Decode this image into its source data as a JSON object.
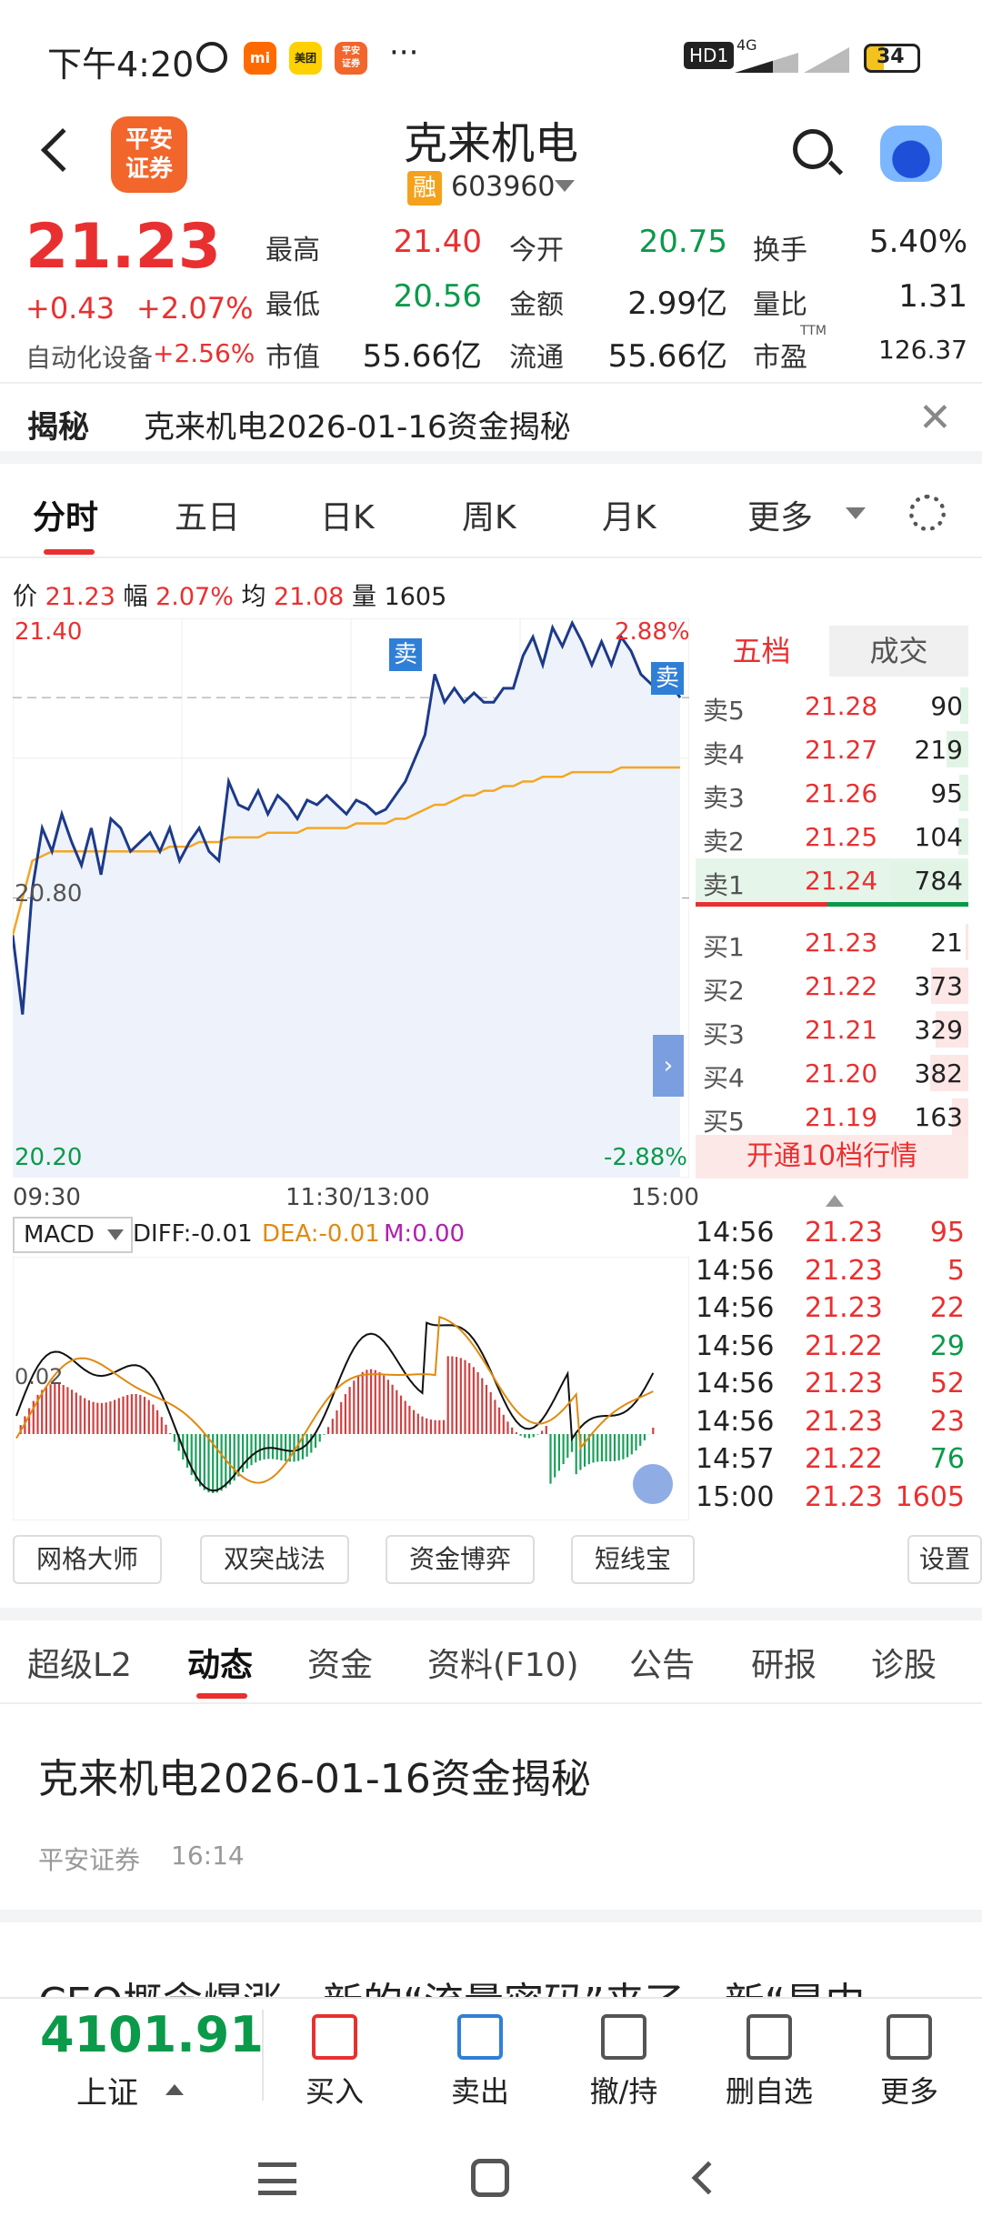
{
  "status_bar": {
    "time": "下午4:20",
    "network": "HD1",
    "signal": "4G",
    "battery": "34"
  },
  "header": {
    "title": "克来机电",
    "badge": "融",
    "code": "603960",
    "logo_text": "平安证券"
  },
  "quote": {
    "price": "21.23",
    "change": "+0.43",
    "change_pct": "+2.07%",
    "sector": "自动化设备",
    "sector_pct": "+2.56%",
    "fields": [
      {
        "label": "最高",
        "value": "21.40",
        "color": "red"
      },
      {
        "label": "今开",
        "value": "20.75",
        "color": "green"
      },
      {
        "label": "换手",
        "value": "5.40%",
        "color": "dark"
      },
      {
        "label": "最低",
        "value": "20.56",
        "color": "green"
      },
      {
        "label": "金额",
        "value": "2.99亿",
        "color": "dark"
      },
      {
        "label": "量比",
        "value": "1.31",
        "color": "dark"
      },
      {
        "label": "市值",
        "value": "55.66亿",
        "color": "dark"
      },
      {
        "label": "流通",
        "value": "55.66亿",
        "color": "dark"
      },
      {
        "label": "市盈",
        "value": "126.37",
        "color": "dark",
        "sup": "TTM"
      }
    ]
  },
  "banner": {
    "tag": "揭秘",
    "text": "克来机电2026-01-16资金揭秘"
  },
  "chart_tabs": [
    "分时",
    "五日",
    "日K",
    "周K",
    "月K",
    "更多"
  ],
  "info_line": {
    "price_lbl": "价",
    "price": "21.23",
    "amp_lbl": "幅",
    "amp": "2.07%",
    "avg_lbl": "均",
    "avg": "21.08",
    "vol_lbl": "量",
    "vol": "1605"
  },
  "chart_data": {
    "type": "line",
    "y_high": "21.40",
    "y_mid": "20.80",
    "y_low": "20.20",
    "pct_high": "2.88%",
    "pct_low": "-2.88%",
    "x_ticks": [
      "09:30",
      "11:30/13:00",
      "15:00"
    ],
    "sell_marker": "卖",
    "series": [
      {
        "name": "价",
        "values": [
          20.72,
          20.55,
          20.82,
          20.95,
          20.9,
          20.98,
          20.92,
          20.87,
          20.95,
          20.85,
          20.97,
          20.95,
          20.9,
          20.92,
          20.94,
          20.9,
          20.95,
          20.88,
          20.92,
          20.95,
          20.9,
          20.88,
          21.05,
          21.0,
          20.99,
          21.03,
          20.98,
          21.02,
          21.0,
          20.97,
          21.01,
          21.0,
          21.02,
          21.0,
          20.98,
          21.01,
          21.0,
          20.98,
          20.99,
          21.02,
          21.05,
          21.1,
          21.15,
          21.28,
          21.22,
          21.25,
          21.22,
          21.24,
          21.22,
          21.22,
          21.25,
          21.25,
          21.32,
          21.36,
          21.3,
          21.38,
          21.34,
          21.39,
          21.35,
          21.3,
          21.35,
          21.3,
          21.36,
          21.33,
          21.28,
          21.26,
          21.24,
          21.26,
          21.23
        ]
      },
      {
        "name": "均",
        "values": [
          20.72,
          20.8,
          20.88,
          20.89,
          20.9,
          20.9,
          20.9,
          20.9,
          20.9,
          20.9,
          20.9,
          20.9,
          20.9,
          20.9,
          20.9,
          20.9,
          20.91,
          20.91,
          20.91,
          20.92,
          20.92,
          20.92,
          20.93,
          20.93,
          20.93,
          20.93,
          20.94,
          20.94,
          20.94,
          20.94,
          20.95,
          20.95,
          20.95,
          20.95,
          20.95,
          20.96,
          20.96,
          20.96,
          20.96,
          20.97,
          20.97,
          20.98,
          20.99,
          21.0,
          21.0,
          21.01,
          21.02,
          21.02,
          21.03,
          21.03,
          21.04,
          21.04,
          21.05,
          21.05,
          21.06,
          21.06,
          21.06,
          21.07,
          21.07,
          21.07,
          21.07,
          21.07,
          21.08,
          21.08,
          21.08,
          21.08,
          21.08,
          21.08,
          21.08
        ]
      }
    ],
    "macd": {
      "label": "MACD",
      "diff": "DIFF:-0.01",
      "dea": "DEA:-0.01",
      "m": "M:0.00",
      "zero_label": "0.02"
    }
  },
  "order_book": {
    "tabs": [
      "五档",
      "成交"
    ],
    "asks": [
      {
        "label": "卖5",
        "price": "21.28",
        "vol": "90",
        "bar": 0.11
      },
      {
        "label": "卖4",
        "price": "21.27",
        "vol": "219",
        "bar": 0.28
      },
      {
        "label": "卖3",
        "price": "21.26",
        "vol": "95",
        "bar": 0.12
      },
      {
        "label": "卖2",
        "price": "21.25",
        "vol": "104",
        "bar": 0.13
      },
      {
        "label": "卖1",
        "price": "21.24",
        "vol": "784",
        "bar": 1.0
      }
    ],
    "bids": [
      {
        "label": "买1",
        "price": "21.23",
        "vol": "21",
        "bar": 0.03
      },
      {
        "label": "买2",
        "price": "21.22",
        "vol": "373",
        "bar": 0.48
      },
      {
        "label": "买3",
        "price": "21.21",
        "vol": "329",
        "bar": 0.42
      },
      {
        "label": "买4",
        "price": "21.20",
        "vol": "382",
        "bar": 0.49
      },
      {
        "label": "买5",
        "price": "21.19",
        "vol": "163",
        "bar": 0.21
      }
    ],
    "promo": "开通10档行情"
  },
  "ticks": [
    {
      "t": "14:56",
      "p": "21.23",
      "v": "95",
      "c": "red"
    },
    {
      "t": "14:56",
      "p": "21.23",
      "v": "5",
      "c": "red"
    },
    {
      "t": "14:56",
      "p": "21.23",
      "v": "22",
      "c": "red"
    },
    {
      "t": "14:56",
      "p": "21.22",
      "v": "29",
      "c": "green"
    },
    {
      "t": "14:56",
      "p": "21.23",
      "v": "52",
      "c": "red"
    },
    {
      "t": "14:56",
      "p": "21.23",
      "v": "23",
      "c": "red"
    },
    {
      "t": "14:57",
      "p": "21.22",
      "v": "76",
      "c": "green"
    },
    {
      "t": "15:00",
      "p": "21.23",
      "v": "1605",
      "c": "red"
    }
  ],
  "tools": [
    "网格大师",
    "双突战法",
    "资金博弈",
    "短线宝",
    "设置"
  ],
  "info_tabs": [
    "超级L2",
    "动态",
    "资金",
    "资料(F10)",
    "公告",
    "研报",
    "诊股"
  ],
  "news": [
    {
      "title": "克来机电2026-01-16资金揭秘",
      "source": "平安证券",
      "time": "16:14"
    },
    {
      "title": "CEO概念爆涨，新的“流量密码”来了，新“昊中"
    }
  ],
  "bottom_bar": {
    "index_value": "4101.91",
    "index_name": "上证",
    "buttons": [
      "买入",
      "卖出",
      "撤/持",
      "删自选",
      "更多"
    ]
  }
}
